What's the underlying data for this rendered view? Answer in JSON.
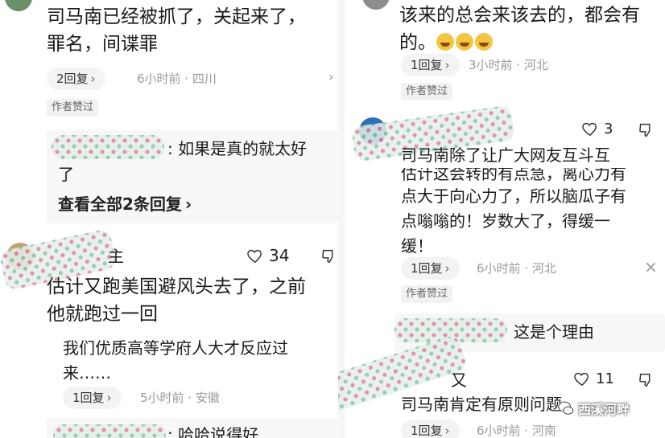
{
  "left": {
    "comment1": {
      "text_line1": "司马南已经被抓了，关起来了，",
      "text_line2": "罪名，间谍罪",
      "replies_pill": "2回复",
      "meta": "6小时前 · 四川",
      "author_liked_tag": "作者赞过",
      "reply_preview_suffix": ": 如果是真的就太好",
      "reply_preview_line2": "了",
      "view_all_label": "查看全部2条回复",
      "view_all_chevron": "›"
    },
    "comment2": {
      "like_count": "34",
      "author_name_fragment": "主",
      "text_line1": "估计又跑美国避风头去了，之前",
      "text_line2": "他就跑过一回"
    },
    "comment3": {
      "text_line1": "我们优质高等学府人大才反应过",
      "text_line2": "来……",
      "replies_pill": "1回复",
      "meta": "5小时前 · 安徽",
      "reply_preview_suffix": ": 哈哈说得好"
    }
  },
  "right": {
    "comment1": {
      "text_line1": "该来的总会来该去的，都会有",
      "text_line2": "的。",
      "replies_pill": "1回复",
      "meta": "3小时前 · 河北",
      "author_liked_tag": "作者赞过"
    },
    "comment2": {
      "like_count": "3",
      "text_line1": "司马南除了让广大网友互斗互",
      "text_line2": "估计这会转的有点急，离心力有",
      "text_line3": "点大于向心力了，所以脑瓜子有",
      "text_line4": "点嗡嗡的！岁数大了，得缓一",
      "text_line5": "缓！",
      "replies_pill": "1回复",
      "meta": "6小时前 · 河北",
      "author_liked_tag": "作者赞过",
      "reply_preview_suffix": "这是个理由"
    },
    "comment3": {
      "like_count": "11",
      "author_name_fragment": "又",
      "text_line1": "司马南肯定有原则问题",
      "replies_pill": "1回复",
      "meta": "6小时前 · 河南"
    },
    "watermark": "西溪河畔"
  },
  "icons": {
    "heart": "heart-icon",
    "dislike": "thumbs-down-icon",
    "close": "close-icon",
    "chevron": "chevron-right-icon",
    "emoji": "laughing-tears-emoji",
    "watermark_logo": "wechat-logo-icon"
  },
  "glyphs": {
    "chevron": "›",
    "close": "×"
  }
}
